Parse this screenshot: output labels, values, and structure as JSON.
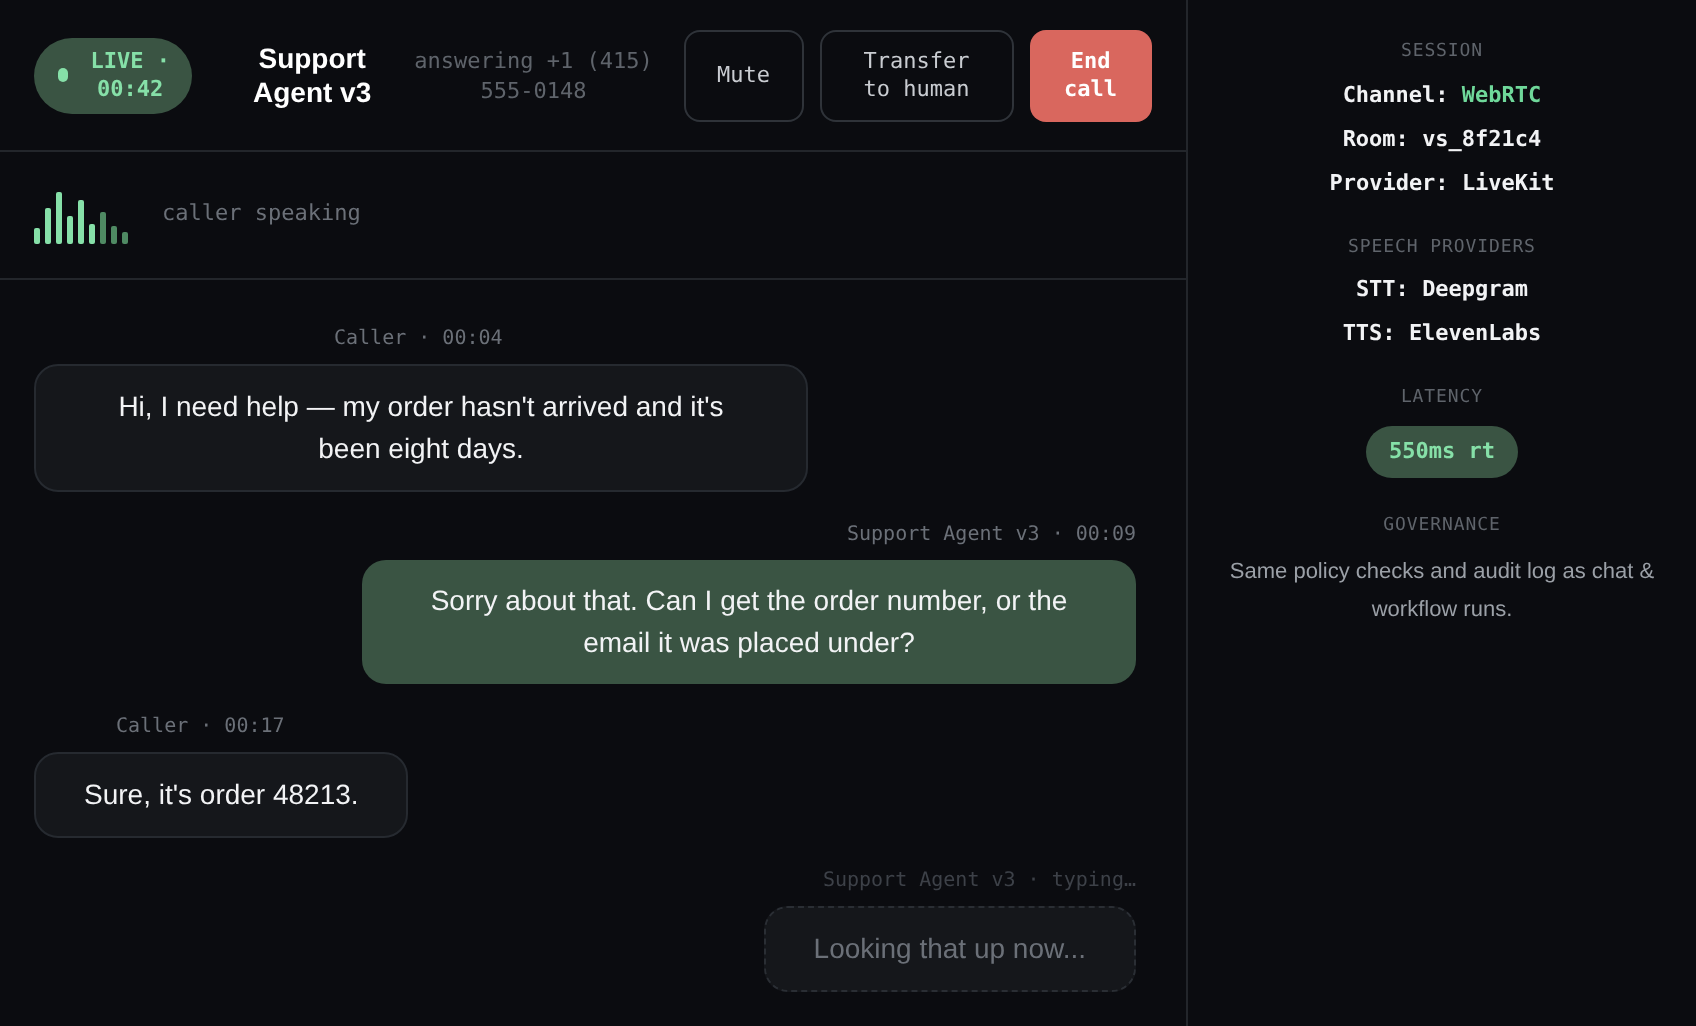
{
  "header": {
    "live_badge": {
      "label": "LIVE · 00:42"
    },
    "title": "Support Agent v3",
    "subtitle": "answering +1 (415) 555-0148",
    "buttons": [
      {
        "label": "Mute",
        "kind": "outline"
      },
      {
        "label": "Transfer to human",
        "kind": "outline"
      },
      {
        "label": "End call",
        "kind": "danger"
      }
    ]
  },
  "voice_activity": {
    "label": "caller speaking"
  },
  "messages": [
    {
      "kind": "caller",
      "meta": "Caller · 00:04",
      "text": "Hi, I need help — my order hasn't arrived and it's been eight days."
    },
    {
      "kind": "agent",
      "meta": "Support Agent v3 · 00:09",
      "text": "Sorry about that. Can I get the order number, or the email it was placed under?"
    },
    {
      "kind": "caller",
      "meta": "Caller · 00:17",
      "text": "Sure, it's order 48213."
    },
    {
      "kind": "typing",
      "meta": "Support Agent v3 · typing…",
      "text": "Looking that up now..."
    }
  ],
  "sidebar": {
    "sections": [
      {
        "heading": "SESSION",
        "rows": [
          {
            "label": "Channel:",
            "value": "WebRTC",
            "highlighted": true
          },
          {
            "label": "Room:",
            "value": "vs_8f21c4",
            "highlighted": false
          },
          {
            "label": "Provider:",
            "value": "LiveKit",
            "highlighted": false
          }
        ]
      },
      {
        "heading": "SPEECH PROVIDERS",
        "rows": [
          {
            "label": "STT:",
            "value": "Deepgram",
            "highlighted": false
          },
          {
            "label": "TTS:",
            "value": "ElevenLabs",
            "highlighted": false
          }
        ]
      },
      {
        "heading": "LATENCY",
        "badge": "550ms rt"
      },
      {
        "heading": "GOVERNANCE",
        "note": "Same policy checks and audit log as chat & workflow runs."
      }
    ]
  }
}
